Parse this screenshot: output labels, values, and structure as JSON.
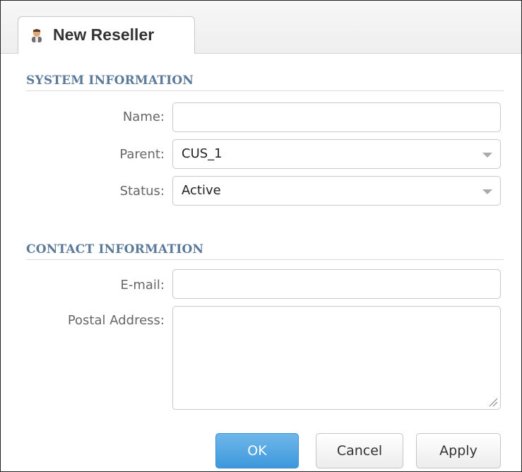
{
  "tab": {
    "title": "New Reseller",
    "icon": "user-icon"
  },
  "sections": {
    "system": {
      "title": "SYSTEM INFORMATION"
    },
    "contact": {
      "title": "CONTACT INFORMATION"
    }
  },
  "form": {
    "name": {
      "label": "Name:",
      "value": ""
    },
    "parent": {
      "label": "Parent:",
      "value": "CUS_1"
    },
    "status": {
      "label": "Status:",
      "value": "Active"
    },
    "email": {
      "label": "E-mail:",
      "value": ""
    },
    "postal": {
      "label": "Postal Address:",
      "value": ""
    }
  },
  "buttons": {
    "ok": "OK",
    "cancel": "Cancel",
    "apply": "Apply"
  },
  "colors": {
    "accent": "#3d98dc",
    "section_title": "#5b7a9a"
  }
}
